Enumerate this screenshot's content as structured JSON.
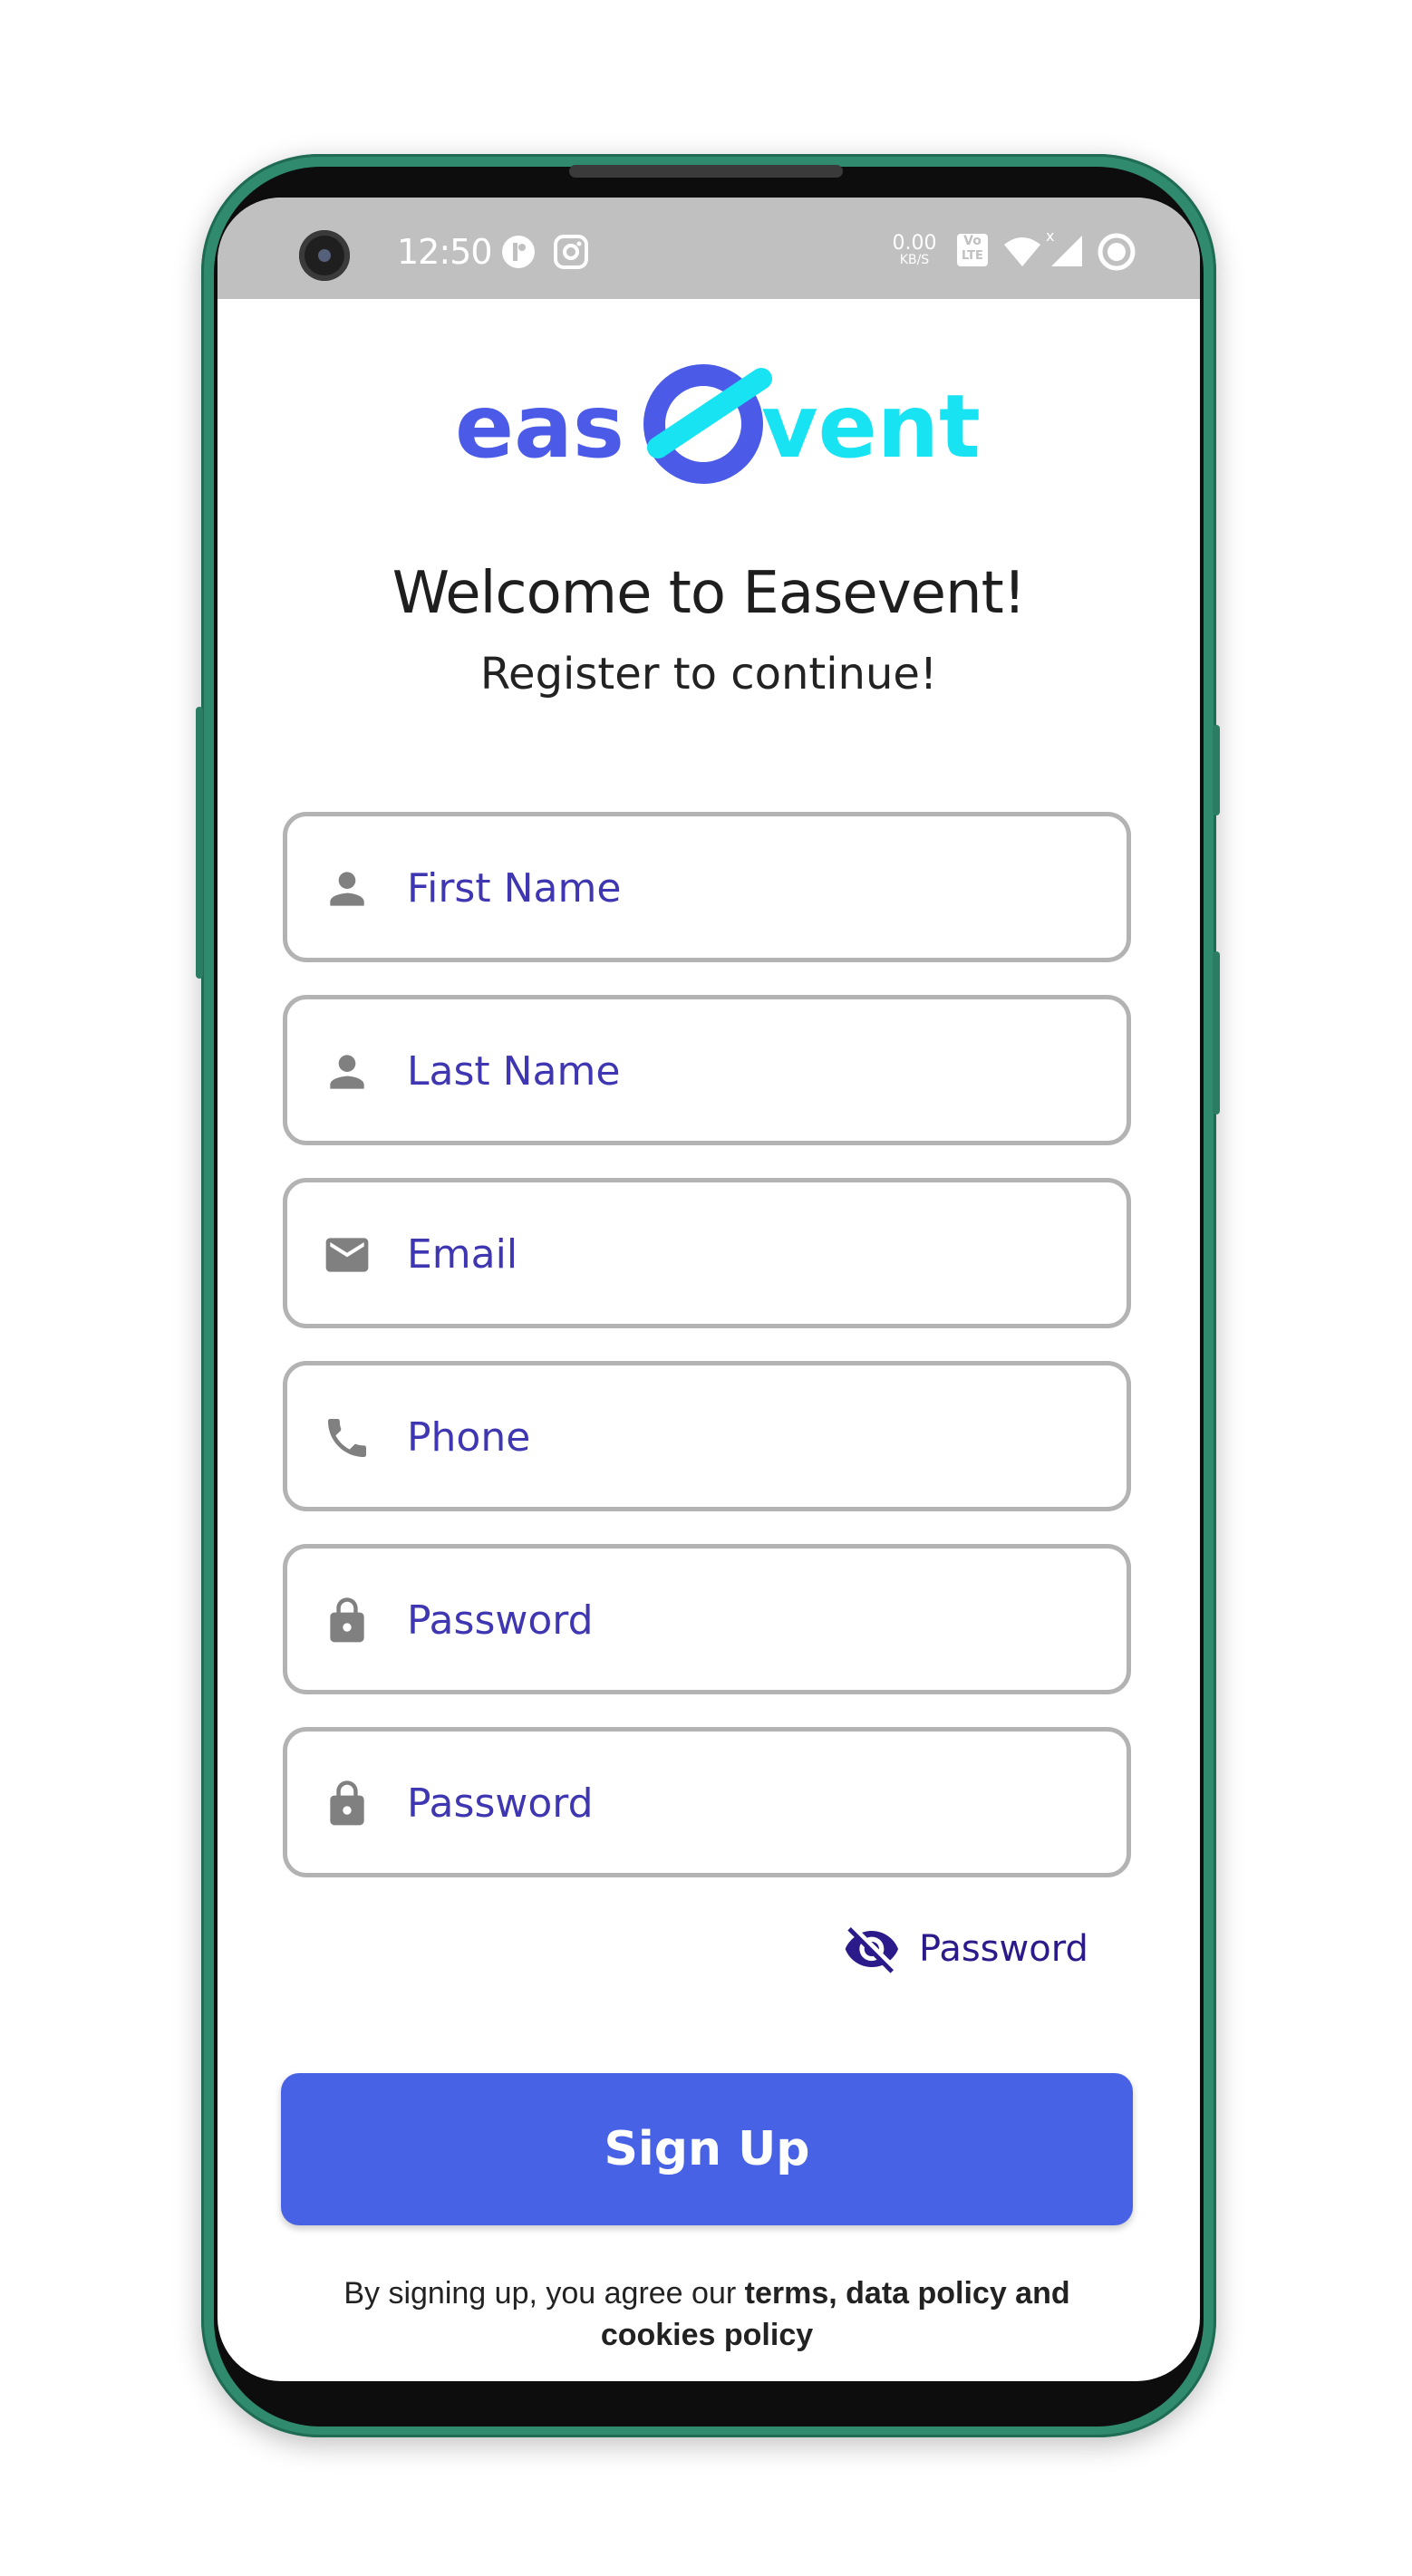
{
  "status_bar": {
    "time": "12:50",
    "net_speed_value": "0.00",
    "net_speed_unit": "KB/S",
    "volte_top": "Vo",
    "volte_bottom": "LTE"
  },
  "brand": {
    "logo_left": "eas",
    "logo_right": "vent",
    "color_primary": "#4B5BE8",
    "color_accent": "#18E3F2"
  },
  "header": {
    "title": "Welcome to Easevent!",
    "subtitle": "Register to continue!"
  },
  "form": {
    "first_name_placeholder": "First Name",
    "last_name_placeholder": "Last Name",
    "email_placeholder": "Email",
    "phone_placeholder": "Phone",
    "password_placeholder": "Password",
    "confirm_password_placeholder": "Password",
    "toggle_label": "Password"
  },
  "actions": {
    "signup_label": "Sign Up"
  },
  "legal": {
    "prefix": "By signing up, you agree our ",
    "bold": "terms, data policy and cookies policy"
  },
  "colors": {
    "button": "#4862E6",
    "input_text": "#3F36B2",
    "field_border": "#B3B3B3",
    "status_bar": "#C0C0C0"
  }
}
